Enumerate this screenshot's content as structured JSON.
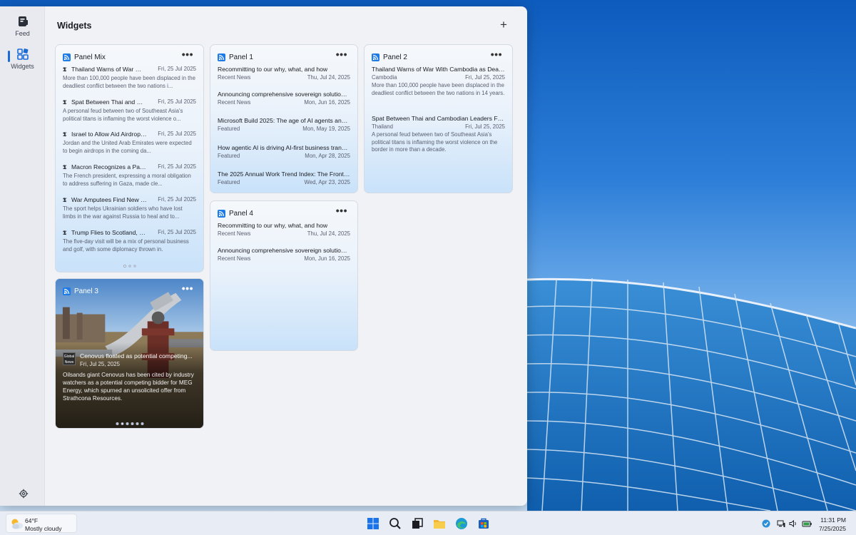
{
  "colors": {
    "accent": "#1a6ad8",
    "rss": "#1e7be6",
    "window_bg": "#f1f2f5"
  },
  "rail": {
    "items": [
      {
        "label": "Feed",
        "icon": "feed-icon",
        "active": false
      },
      {
        "label": "Widgets",
        "icon": "widgets-icon",
        "active": true
      }
    ],
    "settings_icon": "gear-icon"
  },
  "header": {
    "title": "Widgets",
    "add_label": "+"
  },
  "panel_mix": {
    "title": "Panel Mix",
    "items": [
      {
        "title": "Thailand Warns of War With...",
        "date": "Fri, 25 Jul 2025",
        "desc": "More than 100,000 people have been displaced in the deadliest conflict between the two nations i..."
      },
      {
        "title": "Spat Between Thai and Cam...",
        "date": "Fri, 25 Jul 2025",
        "desc": "A personal feud between two of Southeast Asia's political titans is inflaming the worst violence o..."
      },
      {
        "title": "Israel to Allow Aid Airdrops...",
        "date": "Fri, 25 Jul 2025",
        "desc": "Jordan and the United Arab Emirates were expected to begin airdrops in the coming da..."
      },
      {
        "title": "Macron Recognizes a Palesti...",
        "date": "Fri, 25 Jul 2025",
        "desc": "The French president, expressing a moral obligation to address suffering in Gaza, made cle..."
      },
      {
        "title": "War Amputees Find New Pu...",
        "date": "Fri, 25 Jul 2025",
        "desc": "The sport helps Ukrainian soldiers who have lost limbs in the war against Russia to heal and to..."
      },
      {
        "title": "Trump Flies to Scotland, Lea...",
        "date": "Fri, 25 Jul 2025",
        "desc": "The five-day visit will be a mix of personal business and golf, with some diplomacy thrown in."
      }
    ]
  },
  "panel1": {
    "title": "Panel 1",
    "items": [
      {
        "title": "Recommitting to our why, what, and how",
        "category": "Recent News",
        "date": "Thu, Jul 24, 2025"
      },
      {
        "title": "Announcing comprehensive sovereign solutions...",
        "category": "Recent News",
        "date": "Mon, Jun 16, 2025"
      },
      {
        "title": "Microsoft Build 2025: The age of AI agents and b...",
        "category": "Featured",
        "date": "Mon, May 19, 2025"
      },
      {
        "title": "How agentic AI is driving AI-first business transfo...",
        "category": "Featured",
        "date": "Mon, Apr 28, 2025"
      },
      {
        "title": "The 2025 Annual Work Trend Index: The Frontier...",
        "category": "Featured",
        "date": "Wed, Apr 23, 2025"
      }
    ]
  },
  "panel2": {
    "title": "Panel 2",
    "items": [
      {
        "title": "Thailand Warns of War With Cambodia as Deadly...",
        "category": "Cambodia",
        "date": "Fri, Jul 25, 2025",
        "desc": "More than 100,000 people have been displaced in the deadliest conflict between the two nations in 14 years."
      },
      {
        "title": "Spat Between Thai and Cambodian Leaders Fuels...",
        "category": "Thailand",
        "date": "Fri, Jul 25, 2025",
        "desc": "A personal feud between two of Southeast Asia's political titans is inflaming the worst violence on the border in more than a decade."
      }
    ]
  },
  "panel3": {
    "title": "Panel 3",
    "source": "Global News",
    "headline": "Cenovus floated as potential competing...",
    "date": "Fri, Jul 25, 2025",
    "desc": "Oilsands giant Cenovus has been cited by industry watchers as a potential competing bidder for MEG Energy, which spurned an unsolicited offer from Strathcona Resources."
  },
  "panel4": {
    "title": "Panel 4",
    "items": [
      {
        "title": "Recommitting to our why, what, and how",
        "category": "Recent News",
        "date": "Thu, Jul 24, 2025"
      },
      {
        "title": "Announcing comprehensive sovereign solutions...",
        "category": "Recent News",
        "date": "Mon, Jun 16, 2025"
      }
    ]
  },
  "more_label": "•••",
  "taskbar": {
    "weather": {
      "temp": "64°F",
      "condition": "Mostly cloudy"
    },
    "apps": [
      "windows-start-icon",
      "search-icon",
      "task-view-icon",
      "file-explorer-icon",
      "edge-icon",
      "store-icon"
    ],
    "time": "11:31 PM",
    "date": "7/25/2025"
  }
}
